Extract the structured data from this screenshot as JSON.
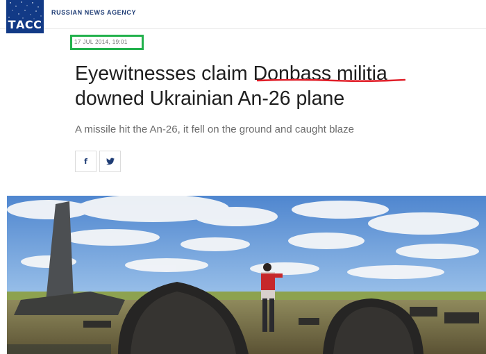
{
  "header": {
    "logo_text": "ТАСС",
    "agency_name": "RUSSIAN NEWS AGENCY"
  },
  "article": {
    "timestamp": "17 JUL 2014, 19:01",
    "headline_line1_prefix": "Eyewitnesses claim ",
    "headline_highlight": "Donbass militia",
    "headline_line2": "downed Ukrainian An-26 plane",
    "subtitle": "A missile hit the An-26, it fell on the ground and caught blaze"
  },
  "share": {
    "facebook_glyph": "f",
    "twitter_icon": "twitter-bird-icon"
  },
  "annotations": {
    "date_box_color": "#22b14c",
    "underline_color": "#e0202a"
  },
  "colors": {
    "brand": "#123a86",
    "sky": "#6f9fd8"
  }
}
